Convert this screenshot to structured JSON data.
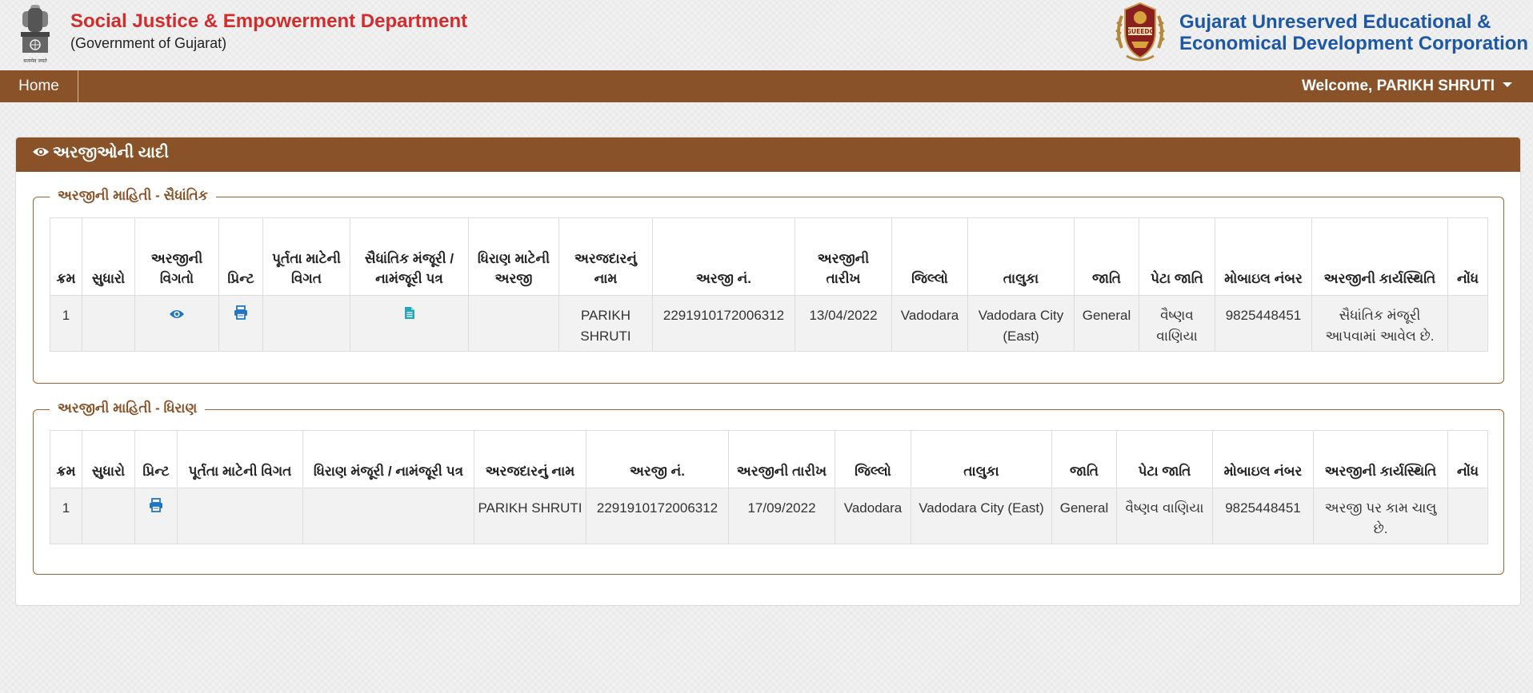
{
  "header": {
    "dept_title": "Social Justice & Empowerment Department",
    "dept_subtitle": "(Government of Gujarat)",
    "emblem_caption": "सत्यमेव जयते",
    "corp_logo_text": "GUEEDC",
    "corp_name_line1": "Gujarat Unreserved Educational &",
    "corp_name_line2": "Economical Development Corporation"
  },
  "nav": {
    "home": "Home",
    "welcome": "Welcome, PARIKH SHRUTI"
  },
  "panel": {
    "title": "અરજીઓની યાદી"
  },
  "colors": {
    "brand_brown": "#8a5228",
    "title_red": "#d22c2c",
    "corp_blue": "#1d58a7",
    "icon_blue": "#1f77c4",
    "doc_teal": "#2aa5b8"
  },
  "section1": {
    "legend": "અરજીની માહિતી - સૈધાંતિક",
    "headers": [
      "ક્રમ",
      "સુધારો",
      "અરજીની વિગતો",
      "પ્રિન્ટ",
      "પૂર્તતા માટેની વિગત",
      "સૈધાંતિક મંજૂરી / નામંજૂરી પત્ર",
      "ધિરાણ માટેની અરજી",
      "અરજદારનું નામ",
      "અરજી નં.",
      "અરજીની તારીખ",
      "જિલ્લો",
      "તાલુકા",
      "જાતિ",
      "પેટા જાતિ",
      "મોબાઇલ નંબર",
      "અરજીની કાર્યસ્થિતિ",
      "નોંધ"
    ],
    "rows": [
      {
        "sr": "1",
        "correction": "",
        "details_icon": "eye-icon",
        "print_icon": "print-icon",
        "compliance": "",
        "letter_icon": "document-icon",
        "loan_application": "",
        "name": "PARIKH SHRUTI",
        "app_no": "2291910172006312",
        "date": "13/04/2022",
        "district": "Vadodara",
        "taluka": "Vadodara City (East)",
        "caste": "General",
        "sub_caste": "વૈષ્ણવ વાણિયા",
        "mobile": "9825448451",
        "status": "સૈધાંતિક મંજૂરી આપવામાં આવેલ છે.",
        "note": ""
      }
    ]
  },
  "section2": {
    "legend": "અરજીની માહિતી - ધિરાણ",
    "headers": [
      "ક્રમ",
      "સુધારો",
      "પ્રિન્ટ",
      "પૂર્તતા માટેની વિગત",
      "ધિરાણ મંજૂરી / નામંજૂરી પત્ર",
      "અરજદારનું નામ",
      "અરજી નં.",
      "અરજીની તારીખ",
      "જિલ્લો",
      "તાલુકા",
      "જાતિ",
      "પેટા જાતિ",
      "મોબાઇલ નંબર",
      "અરજીની કાર્યસ્થિતિ",
      "નોંધ"
    ],
    "rows": [
      {
        "sr": "1",
        "correction": "",
        "print_icon": "print-icon",
        "compliance": "",
        "letter": "",
        "name": "PARIKH SHRUTI",
        "app_no": "2291910172006312",
        "date": "17/09/2022",
        "district": "Vadodara",
        "taluka": "Vadodara City (East)",
        "caste": "General",
        "sub_caste": "વૈષ્ણવ વાણિયા",
        "mobile": "9825448451",
        "status": "અરજી પર કામ ચાલુ છે.",
        "note": ""
      }
    ]
  }
}
